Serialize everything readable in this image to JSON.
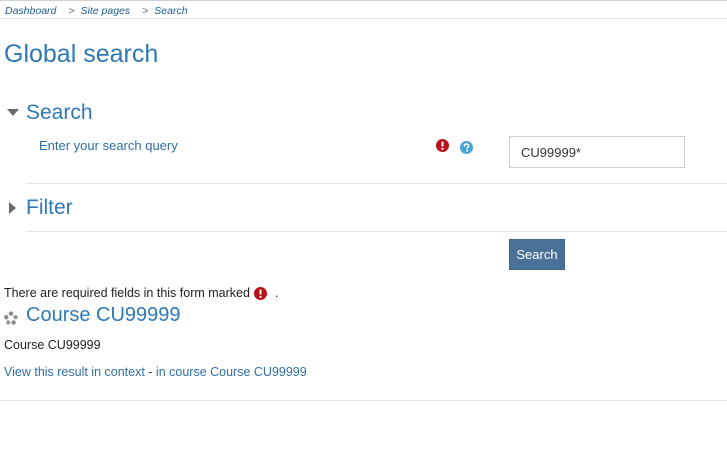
{
  "breadcrumb": {
    "items": [
      "Dashboard",
      "Site pages",
      "Search"
    ],
    "separator": ">"
  },
  "page": {
    "title": "Global search"
  },
  "form": {
    "search_section": {
      "title": "Search",
      "expanded": true,
      "field_label": "Enter your search query",
      "query_value": "CU99999*"
    },
    "filter_section": {
      "title": "Filter",
      "expanded": false
    },
    "submit_label": "Search",
    "required_note": "There are required fields in this form marked",
    "required_note_end": "."
  },
  "results": [
    {
      "title": "Course CU99999",
      "summary": "Course CU99999",
      "context_link": "View this result in context",
      "separator": " - ",
      "course_link": "in course Course CU99999"
    }
  ],
  "colors": {
    "link": "#2f79b5",
    "required": "#b7131a",
    "help": "#4aa5d6",
    "button": "#4a7299"
  },
  "icons": {
    "required": "exclamation-circle-icon",
    "help": "question-circle-icon",
    "section_expanded": "caret-down-icon",
    "section_collapsed": "caret-right-icon",
    "result": "course-icon"
  }
}
